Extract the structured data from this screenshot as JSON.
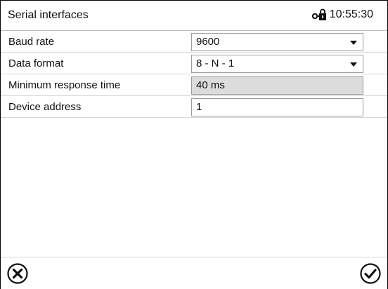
{
  "header": {
    "title": "Serial interfaces",
    "time": "10:55:30",
    "lock_icon": "lock-key-icon"
  },
  "settings": [
    {
      "label": "Baud rate",
      "value": "9600",
      "type": "dropdown"
    },
    {
      "label": "Data format",
      "value": "8 - N - 1",
      "type": "dropdown"
    },
    {
      "label": "Minimum response time",
      "value": "40 ms",
      "type": "readonly"
    },
    {
      "label": "Device address",
      "value": "1",
      "type": "input"
    }
  ],
  "footer": {
    "cancel_icon": "circle-x-icon",
    "confirm_icon": "circle-check-icon"
  }
}
